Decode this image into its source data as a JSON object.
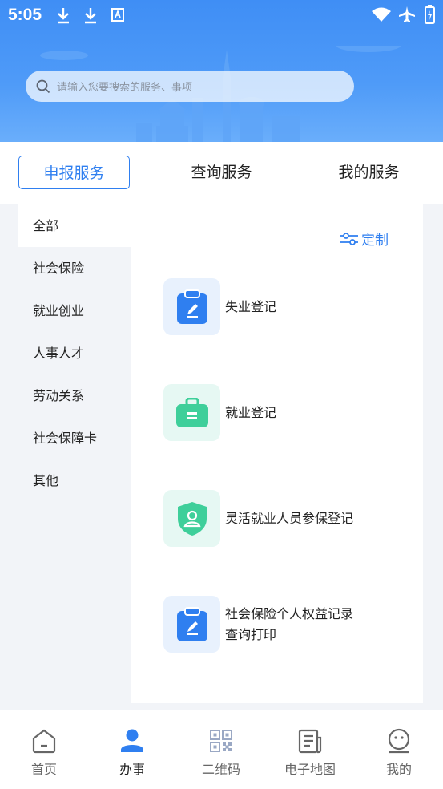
{
  "status_bar": {
    "time": "5:05",
    "icons": [
      "download-icon",
      "download-icon",
      "translate-icon",
      "wifi-icon",
      "airplane-icon",
      "battery-icon"
    ]
  },
  "search": {
    "placeholder": "请输入您要搜索的服务、事项"
  },
  "tabs": [
    {
      "label": "申报服务",
      "active": true
    },
    {
      "label": "查询服务",
      "active": false
    },
    {
      "label": "我的服务",
      "active": false
    }
  ],
  "categories": [
    {
      "label": "全部",
      "active": true
    },
    {
      "label": "社会保险",
      "active": false
    },
    {
      "label": "就业创业",
      "active": false
    },
    {
      "label": "人事人才",
      "active": false
    },
    {
      "label": "劳动关系",
      "active": false
    },
    {
      "label": "社会保障卡",
      "active": false
    },
    {
      "label": "其他",
      "active": false
    }
  ],
  "custom_label": "定制",
  "services": [
    {
      "label": "失业登记",
      "icon": "clipboard-edit-icon"
    },
    {
      "label": "就业登记",
      "icon": "briefcase-icon"
    },
    {
      "label": "灵活就业人员参保登记",
      "icon": "shield-user-icon"
    },
    {
      "label": "社会保险个人权益记录查询打印",
      "icon": "clipboard-edit-icon"
    }
  ],
  "bottom_nav": [
    {
      "label": "首页",
      "icon": "home-icon",
      "active": false
    },
    {
      "label": "办事",
      "icon": "person-icon",
      "active": true
    },
    {
      "label": "二维码",
      "icon": "qrcode-icon",
      "active": false
    },
    {
      "label": "电子地图",
      "icon": "map-doc-icon",
      "active": false
    },
    {
      "label": "我的",
      "icon": "smiley-icon",
      "active": false
    }
  ],
  "colors": {
    "primary": "#2f7ff0",
    "banner": "#4f9bf8",
    "green": "#3ecf9a"
  }
}
